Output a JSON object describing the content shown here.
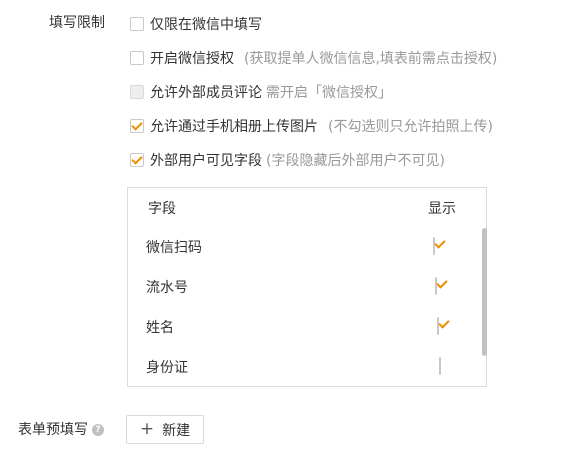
{
  "fill_restrictions": {
    "label": "填写限制",
    "options": [
      {
        "label": "仅限在微信中填写",
        "hint": "",
        "checked": false,
        "disabled": false
      },
      {
        "label": "开启微信授权",
        "hint": "(获取提单人微信信息,填表前需点击授权)",
        "checked": false,
        "disabled": false
      },
      {
        "label": "允许外部成员评论",
        "hint": "需开启「微信授权」",
        "checked": false,
        "disabled": true
      },
      {
        "label": "允许通过手机相册上传图片",
        "hint": "(不勾选则只允许拍照上传)",
        "checked": true,
        "disabled": false
      },
      {
        "label": "外部用户可见字段",
        "hint": "(字段隐藏后外部用户不可见)",
        "checked": true,
        "disabled": false
      }
    ]
  },
  "fields_table": {
    "headers": {
      "field": "字段",
      "show": "显示"
    },
    "rows": [
      {
        "field": "微信扫码",
        "show": true
      },
      {
        "field": "流水号",
        "show": true
      },
      {
        "field": "姓名",
        "show": true
      },
      {
        "field": "身份证",
        "show": false
      }
    ]
  },
  "prefill": {
    "label": "表单预填写",
    "help_icon": "question-circle-icon",
    "new_button_label": "新建",
    "new_button_icon": "plus-icon"
  },
  "colors": {
    "accent_check": "#f08c00",
    "hint_text": "#999999",
    "border": "#dcdcdc"
  }
}
